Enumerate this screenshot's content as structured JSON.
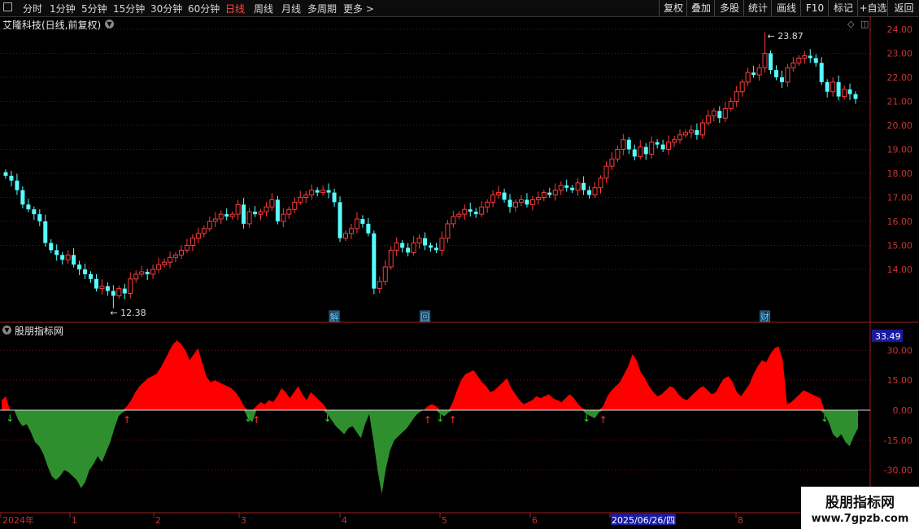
{
  "toolbar": {
    "left_items": [
      {
        "label": "分时",
        "active": false
      },
      {
        "label": "1分钟",
        "active": false
      },
      {
        "label": "5分钟",
        "active": false
      },
      {
        "label": "15分钟",
        "active": false
      },
      {
        "label": "30分钟",
        "active": false
      },
      {
        "label": "60分钟",
        "active": false
      },
      {
        "label": "日线",
        "active": true
      },
      {
        "label": "周线",
        "active": false
      },
      {
        "label": "月线",
        "active": false
      },
      {
        "label": "多周期",
        "active": false
      },
      {
        "label": "更多 >",
        "active": false
      }
    ],
    "right_items": [
      "复权",
      "叠加",
      "多股",
      "统计",
      "画线",
      "F10",
      "标记",
      "+自选",
      "返回"
    ]
  },
  "stock_title": "艾隆科技(日线,前复权)",
  "indicator_title": "股朋指标网",
  "watermark": {
    "line1": "股朋指标网",
    "line2": "www.7gpzb.com"
  },
  "colors": {
    "up": "#ff3b3b",
    "down": "#54ffff",
    "pos_area": "#ff0000",
    "neg_area": "#2f8f2f",
    "grid": "#7a1010",
    "axis": "#a02020"
  },
  "chart_data": [
    {
      "type": "candlestick",
      "y_ticks": [
        14.0,
        15.0,
        16.0,
        17.0,
        18.0,
        19.0,
        20.0,
        21.0,
        22.0,
        23.0,
        24.0
      ],
      "y_tick_labels": [
        "14.00",
        "15.00",
        "16.00",
        "17.00",
        "18.00",
        "19.00",
        "20.00",
        "21.00",
        "22.00",
        "23.00",
        "24.00"
      ],
      "ylim": [
        12.0,
        24.3
      ],
      "max_label": "23.87",
      "min_label": "12.38",
      "event_markers": [
        {
          "label": "解",
          "index": 58
        },
        {
          "label": "回",
          "index": 74
        },
        {
          "label": "财",
          "index": 134
        }
      ],
      "closes": [
        17.9,
        17.7,
        17.3,
        16.7,
        16.5,
        16.3,
        16.0,
        15.1,
        14.8,
        14.6,
        14.4,
        14.6,
        14.2,
        14.0,
        13.8,
        13.6,
        13.2,
        13.3,
        13.1,
        12.9,
        13.2,
        13.0,
        13.6,
        13.8,
        13.9,
        13.8,
        14.0,
        14.2,
        14.3,
        14.5,
        14.6,
        14.8,
        15.0,
        15.3,
        15.5,
        15.7,
        16.0,
        16.1,
        16.3,
        16.2,
        16.3,
        16.7,
        15.9,
        16.4,
        16.3,
        16.4,
        16.6,
        16.9,
        16.0,
        16.3,
        16.5,
        16.8,
        17.0,
        17.1,
        17.3,
        17.2,
        17.3,
        17.2,
        16.8,
        15.3,
        15.5,
        15.7,
        16.1,
        15.9,
        15.5,
        13.2,
        13.5,
        14.1,
        14.8,
        15.1,
        14.9,
        14.7,
        15.1,
        15.3,
        15.0,
        14.9,
        14.8,
        15.3,
        15.9,
        16.2,
        16.3,
        16.5,
        16.4,
        16.3,
        16.6,
        16.8,
        17.1,
        17.2,
        16.9,
        16.6,
        16.8,
        16.9,
        16.7,
        16.9,
        17.0,
        17.2,
        17.1,
        17.3,
        17.5,
        17.4,
        17.3,
        17.6,
        17.3,
        17.1,
        17.4,
        17.8,
        18.3,
        18.6,
        19.0,
        19.4,
        19.0,
        18.7,
        19.1,
        18.8,
        19.3,
        19.2,
        19.0,
        19.3,
        19.4,
        19.6,
        19.7,
        19.8,
        19.6,
        20.1,
        20.4,
        20.6,
        20.3,
        20.7,
        21.0,
        21.4,
        21.8,
        22.2,
        22.1,
        22.4,
        23.0,
        22.3,
        22.0,
        21.8,
        22.4,
        22.6,
        22.8,
        22.9,
        22.8,
        22.6,
        21.8,
        21.4,
        21.8,
        21.2,
        21.5,
        21.3,
        21.1
      ]
    },
    {
      "type": "area",
      "y_ticks": [
        30.0,
        15.0,
        0.0,
        -15.0,
        -30.0
      ],
      "y_tick_labels": [
        "30.00",
        "15.00",
        "0.00",
        "-15.00",
        "-30.00"
      ],
      "ylim": [
        -38.0,
        38.0
      ],
      "current_value_label": "33.49",
      "x_labels": [
        "2024年",
        "1",
        "2",
        "3",
        "4",
        "5",
        "6",
        "2025/06/26/四",
        "8"
      ],
      "values": [
        5,
        7,
        0,
        0,
        -5,
        -8,
        -7,
        -11,
        -16,
        -18,
        -22,
        -28,
        -33,
        -35,
        -33,
        -30,
        -31,
        -33,
        -35,
        -39,
        -36,
        -30,
        -27,
        -23,
        -26,
        -21,
        -16,
        -9,
        -3,
        -1,
        2,
        5,
        9,
        12,
        14,
        16,
        17,
        18,
        21,
        25,
        29,
        33,
        35,
        33,
        30,
        25,
        28,
        31,
        24,
        17,
        14,
        15,
        14,
        13,
        12,
        11,
        9,
        6,
        2,
        -4,
        -6,
        2,
        4,
        3,
        5,
        4,
        7,
        11,
        9,
        6,
        9,
        12,
        8,
        5,
        9,
        7,
        5,
        3,
        -2,
        -5,
        -8,
        -10,
        -12,
        -9,
        -8,
        -11,
        -14,
        -7,
        -2,
        -15,
        -30,
        -42,
        -29,
        -20,
        -15,
        -13,
        -11,
        -9,
        -6,
        -3,
        -1,
        0,
        2,
        3,
        2,
        -2,
        -3,
        -1,
        4,
        10,
        15,
        18,
        19,
        20,
        17,
        14,
        12,
        9,
        10,
        12,
        14,
        16,
        11,
        8,
        5,
        3,
        4,
        5,
        7,
        6,
        7,
        8,
        6,
        5,
        4,
        6,
        8,
        6,
        3,
        1,
        -2,
        -3,
        -4,
        -1,
        2,
        7,
        10,
        12,
        14,
        18,
        22,
        28,
        25,
        19,
        16,
        12,
        9,
        7,
        8,
        10,
        12,
        11,
        8,
        6,
        5,
        7,
        9,
        11,
        12,
        10,
        8,
        9,
        13,
        16,
        17,
        14,
        9,
        7,
        10,
        13,
        18,
        22,
        25,
        24,
        28,
        31,
        32,
        25,
        3,
        4,
        6,
        8,
        10,
        9,
        8,
        7,
        6,
        -2,
        -6,
        -12,
        -14,
        -12,
        -16,
        -18,
        -13,
        -9
      ]
    }
  ]
}
